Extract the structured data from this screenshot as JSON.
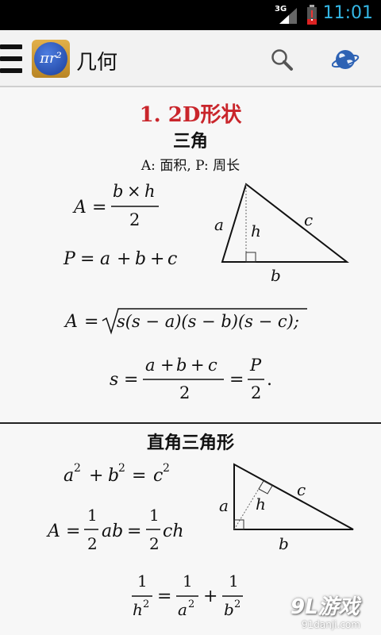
{
  "status_bar": {
    "network": "3G",
    "time": "11:01"
  },
  "action_bar": {
    "logo_text": "πr²",
    "title": "几何"
  },
  "section1": {
    "heading": "1. 2D形状",
    "triangle": {
      "title": "三角",
      "legend": "A: 面积, P: 周长"
    }
  },
  "section2": {
    "title": "直角三角形"
  },
  "watermark": {
    "main": "9L游戏",
    "sub": "91danji.com"
  },
  "colors": {
    "heading_red": "#c9252b",
    "clock_blue": "#34b6e4",
    "status_bar": "#000000"
  },
  "icons": [
    "menu-icon",
    "app-logo",
    "search-icon",
    "globe-icon",
    "battery-icon",
    "signal-icon"
  ]
}
